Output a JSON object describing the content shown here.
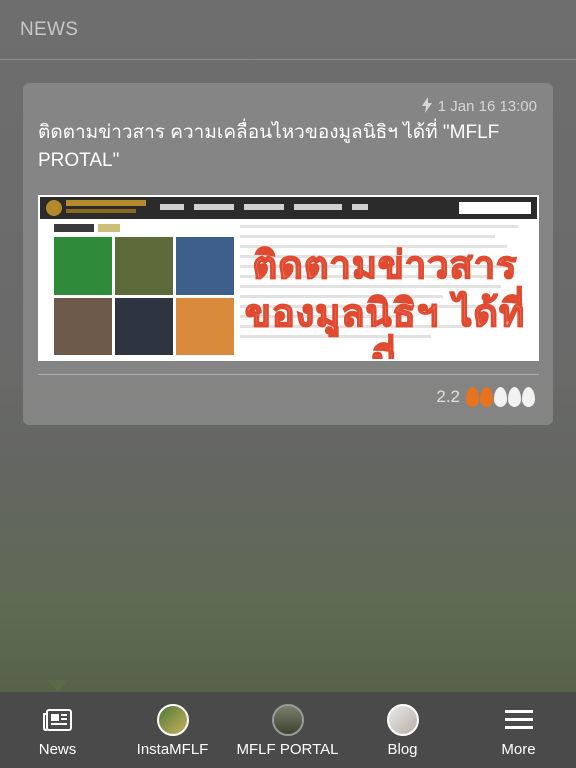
{
  "header": {
    "title": "NEWS"
  },
  "post": {
    "timestamp": "1 Jan 16 13:00",
    "title": "ติดตามข่าวสาร ความเคลื่อนไหวของมูลนิธิฯ ได้ที่ \"MFLF PROTAL\"",
    "image_overlay_text": "ติดตามข่าวสาร ของมูลนิธิฯ ได้ที่นี่",
    "rating": "2.2",
    "rating_out_of": 5,
    "rating_filled": 2
  },
  "tabs": [
    {
      "label": "News",
      "icon": "newspaper-icon"
    },
    {
      "label": "InstaMFLF",
      "icon": "insta-avatar-icon"
    },
    {
      "label": "MFLF PORTAL",
      "icon": "portal-avatar-icon"
    },
    {
      "label": "Blog",
      "icon": "blog-avatar-icon"
    },
    {
      "label": "More",
      "icon": "hamburger-menu-icon"
    }
  ],
  "colors": {
    "flame_filled": "#e8731e",
    "flame_empty": "#f2f2f2"
  }
}
